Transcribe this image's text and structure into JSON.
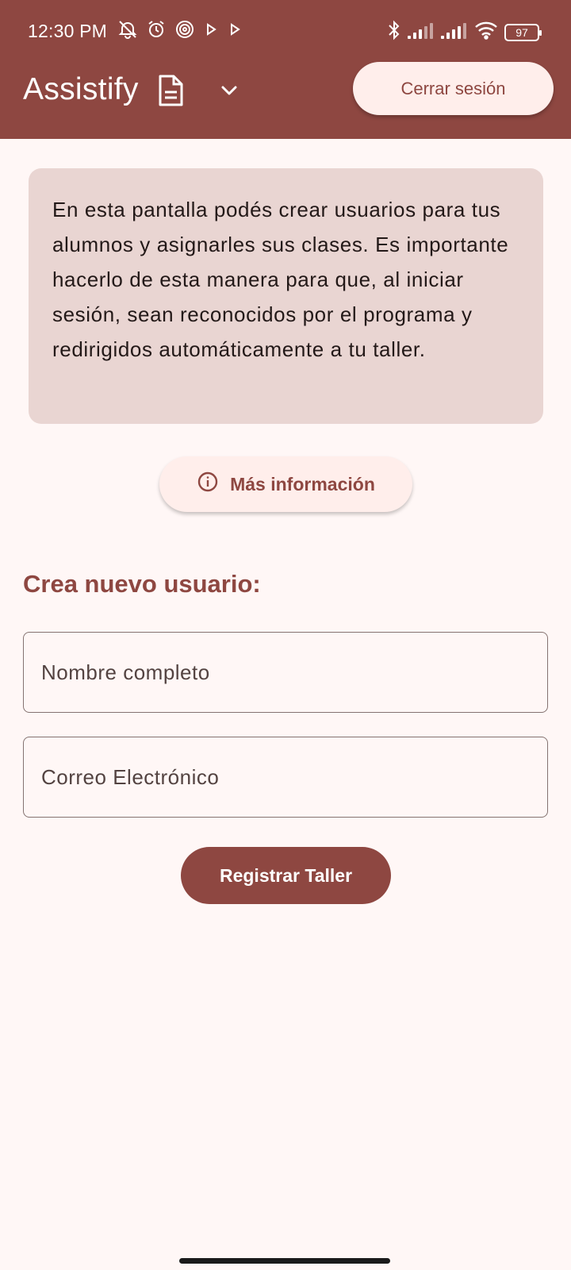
{
  "status_bar": {
    "time": "12:30 PM",
    "battery": "97",
    "left_icons": [
      "mute-icon",
      "alarm-icon",
      "fingerprint-icon",
      "play-icon",
      "play-icon"
    ],
    "right_icons": [
      "bluetooth-icon",
      "signal-icon",
      "signal-icon",
      "wifi-icon",
      "battery-icon"
    ]
  },
  "app_bar": {
    "title": "Assistify",
    "logout_label": "Cerrar sesión"
  },
  "info_card": {
    "text": "En esta pantalla podés crear usuarios para tus alumnos y asignarles sus clases. Es importante hacerlo de esta manera para que, al iniciar sesión, sean reconocidos por el programa y redirigidos automáticamente a tu taller."
  },
  "more_info_label": "Más información",
  "form": {
    "title": "Crea nuevo usuario:",
    "name_placeholder": "Nombre completo",
    "email_placeholder": "Correo Electrónico",
    "submit_label": "Registrar Taller"
  },
  "colors": {
    "primary": "#8e4741",
    "background": "#fff7f6",
    "card": "#e9d5d2",
    "button_tonal": "#ffeeeb"
  }
}
